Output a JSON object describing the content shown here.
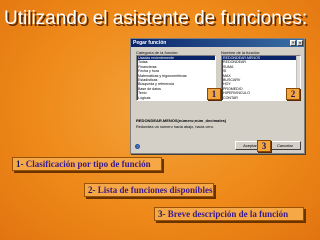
{
  "title": "Utilizando el asistente de funciones:",
  "dialog": {
    "title": "Pegar función",
    "category_label": "Categoría de la función:",
    "function_label": "Nombre de la función:",
    "categories": [
      "Usadas recientemente",
      "Todas",
      "Financieras",
      "Fecha y hora",
      "Matemáticas y trigonométricas",
      "Estadísticas",
      "Búsqueda y referencia",
      "Base de datos",
      "Texto",
      "Lógicas"
    ],
    "functions": [
      "REDONDEAR.MENOS",
      "REDONDEAR",
      "SUMA",
      "SI",
      "MAX",
      "BUSCARV",
      "HOY",
      "PROMEDIO",
      "HIPERVINCULO",
      "CONTAR"
    ],
    "syntax": "REDONDEAR.MENOS(número;núm_decimales)",
    "description": "Redondea un número hacia abajo, hacia cero.",
    "help_icon": "?",
    "ok_label": "Aceptar",
    "cancel_label": "Cancelar"
  },
  "markers": [
    "1",
    "2",
    "3"
  ],
  "captions": [
    {
      "num": "1-",
      "text": "Clasificación por tipo de función"
    },
    {
      "num": "2-",
      "text": "Lista de funciones disponibles"
    },
    {
      "num": "3-",
      "text": "Breve descripción de la función"
    }
  ]
}
